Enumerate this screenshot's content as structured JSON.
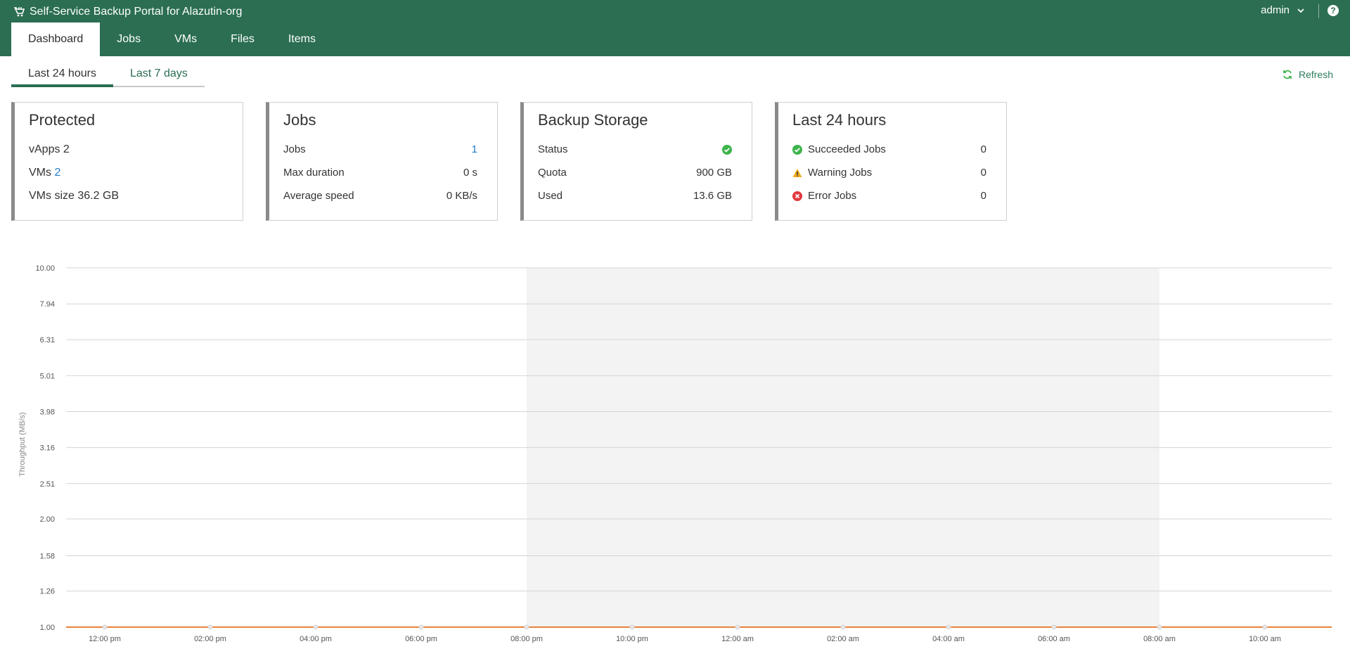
{
  "header": {
    "title": "Self-Service Backup Portal for Alazutin-org",
    "user": "admin",
    "help_label": "?"
  },
  "nav": {
    "tabs": [
      {
        "label": "Dashboard",
        "active": true
      },
      {
        "label": "Jobs",
        "active": false
      },
      {
        "label": "VMs",
        "active": false
      },
      {
        "label": "Files",
        "active": false
      },
      {
        "label": "Items",
        "active": false
      }
    ]
  },
  "period_tabs": [
    {
      "label": "Last 24 hours",
      "active": true
    },
    {
      "label": "Last 7 days",
      "active": false
    }
  ],
  "refresh_label": "Refresh",
  "cards": {
    "protected": {
      "title": "Protected",
      "rows": [
        {
          "label": "vApps",
          "value": "2"
        },
        {
          "label": "VMs",
          "value": "2"
        },
        {
          "label": "VMs size",
          "value": "36.2 GB"
        }
      ]
    },
    "jobs": {
      "title": "Jobs",
      "rows": [
        {
          "label": "Jobs",
          "value": "1"
        },
        {
          "label": "Max duration",
          "value": "0 s"
        },
        {
          "label": "Average speed",
          "value": "0 KB/s"
        }
      ]
    },
    "storage": {
      "title": "Backup Storage",
      "rows": [
        {
          "label": "Status",
          "value": ""
        },
        {
          "label": "Quota",
          "value": "900 GB"
        },
        {
          "label": "Used",
          "value": "13.6 GB"
        }
      ]
    },
    "last24": {
      "title": "Last 24 hours",
      "rows": [
        {
          "label": "Succeeded Jobs",
          "value": "0",
          "icon": "success-icon"
        },
        {
          "label": "Warning Jobs",
          "value": "0",
          "icon": "warning-icon"
        },
        {
          "label": "Error Jobs",
          "value": "0",
          "icon": "error-icon"
        }
      ]
    }
  },
  "colors": {
    "header": "#2b6e52",
    "success": "#3cb44b",
    "warning": "#f0ad1e",
    "error": "#e0393e",
    "line": "#e8823a",
    "link": "#1f7ac7"
  },
  "chart_data": {
    "type": "line",
    "ylabel": "Throughput (MB/s)",
    "yticks": [
      "10.00",
      "7.94",
      "6.31",
      "5.01",
      "3.98",
      "3.16",
      "2.51",
      "2.00",
      "1.58",
      "1.26",
      "1.00"
    ],
    "ylim": [
      1,
      10
    ],
    "yscale": "log",
    "x": [
      "12:00 pm",
      "02:00 pm",
      "04:00 pm",
      "06:00 pm",
      "08:00 pm",
      "10:00 pm",
      "12:00 am",
      "02:00 am",
      "04:00 am",
      "06:00 am",
      "08:00 am",
      "10:00 am"
    ],
    "series": [
      {
        "values": [
          1,
          1,
          1,
          1,
          1,
          1,
          1,
          1,
          1,
          1,
          1,
          1
        ]
      }
    ],
    "shaded_range": [
      "08:00 pm",
      "08:00 am"
    ],
    "grid": true
  }
}
